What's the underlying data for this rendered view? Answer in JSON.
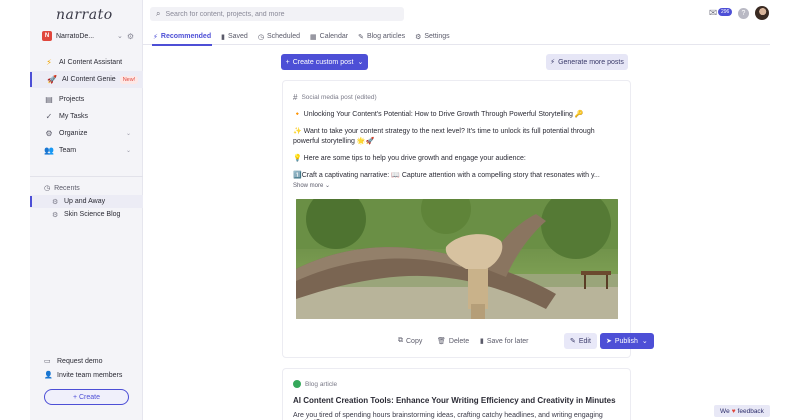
{
  "app": {
    "logo": "narrato"
  },
  "workspace": {
    "initial": "N",
    "name": "NarratoDe..."
  },
  "sidebar": {
    "items": [
      {
        "label": "AI Content Assistant",
        "icon": "lightning-icon"
      },
      {
        "label": "AI Content Genie",
        "badge": "New!",
        "icon": "rocket-icon",
        "active": true
      },
      {
        "label": "Projects",
        "icon": "folder-icon"
      },
      {
        "label": "My Tasks",
        "icon": "check-icon"
      },
      {
        "label": "Organize",
        "icon": "organize-icon"
      },
      {
        "label": "Team",
        "icon": "team-icon"
      }
    ],
    "recents_title": "Recents",
    "recents": [
      {
        "label": "Up and Away",
        "active": true
      },
      {
        "label": "Skin Science Blog"
      }
    ],
    "request_demo": "Request demo",
    "invite": "Invite team members",
    "create": "+ Create"
  },
  "topbar": {
    "search_placeholder": "Search for content, projects, and more",
    "mail_count": "296",
    "help": "?"
  },
  "tabs": [
    {
      "label": "Recommended",
      "active": true
    },
    {
      "label": "Saved"
    },
    {
      "label": "Scheduled"
    },
    {
      "label": "Calendar"
    },
    {
      "label": "Blog articles"
    },
    {
      "label": "Settings"
    }
  ],
  "main": {
    "create_custom_post": "Create custom post",
    "generate_more_posts": "Generate more posts"
  },
  "post": {
    "type_label": "Social media post (edited)",
    "p1": "🔸 Unlocking Your Content's Potential: How to Drive Growth Through Powerful Storytelling 🔑",
    "p2": "✨ Want to take your content strategy to the next level? It's time to unlock its full potential through powerful storytelling 🌟🚀",
    "p3": "💡 Here are some tips to help you drive growth and engage your audience:",
    "p4": "1️⃣Craft a captivating narrative: 📖 Capture attention with a compelling story that resonates with y...",
    "show_more": "Show more",
    "actions": {
      "copy": "Copy",
      "delete": "Delete",
      "save_later": "Save for later",
      "edit": "Edit",
      "publish": "Publish"
    }
  },
  "post2": {
    "type_label": "Blog article",
    "title": "AI Content Creation Tools: Enhance Your Writing Efficiency and Creativity in Minutes",
    "body": "Are you tired of spending hours brainstorming ideas, crafting catchy headlines, and writing engaging content?"
  },
  "feedback": {
    "pre": "We",
    "post": "feedback"
  },
  "colors": {
    "accent": "#4d4fd6",
    "brand_red": "#e0463c"
  }
}
